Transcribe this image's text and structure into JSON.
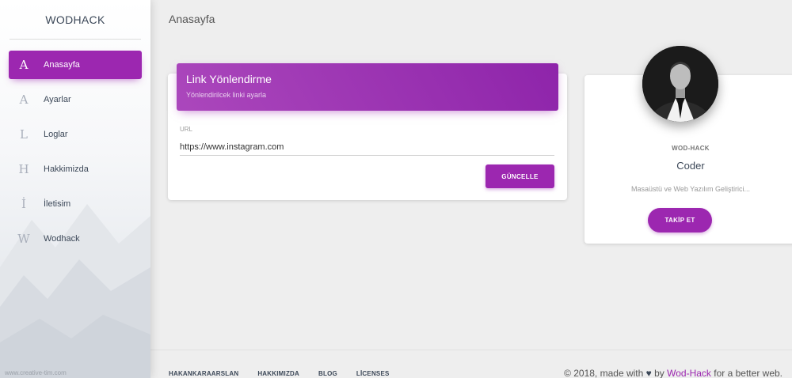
{
  "sidebar": {
    "brand": "WODHACK",
    "items": [
      {
        "letter": "A",
        "label": "Anasayfa",
        "active": true
      },
      {
        "letter": "A",
        "label": "Ayarlar"
      },
      {
        "letter": "L",
        "label": "Loglar"
      },
      {
        "letter": "H",
        "label": "Hakkimizda"
      },
      {
        "letter": "İ",
        "label": "İletisim"
      },
      {
        "letter": "W",
        "label": "Wodhack"
      }
    ],
    "watermark": "www.creative-tim.com"
  },
  "topbar": {
    "title": "Anasayfa"
  },
  "link_card": {
    "title": "Link Yönlendirme",
    "subtitle": "Yönlendirilcek linki ayarla",
    "url_label": "URL",
    "url_value": "https://www.instagram.com",
    "update_button": "GÜNCELLE"
  },
  "profile_card": {
    "category": "WOD-HACK",
    "name": "Coder",
    "description": "Masaüstü ve Web Yazılım Geliştirici...",
    "follow_button": "TAKİP ET"
  },
  "footer": {
    "links": [
      "HAKANKARAARSLAN",
      "HAKKIMIZDA",
      "BLOG",
      "LİCENSES"
    ],
    "copyright_prefix": "© 2018, made with",
    "heart": "♥",
    "copyright_by": "by",
    "brand_link": "Wod-Hack",
    "copyright_suffix": "for a better web."
  },
  "colors": {
    "accent": "#9c27b0",
    "background": "#eeeeee"
  }
}
